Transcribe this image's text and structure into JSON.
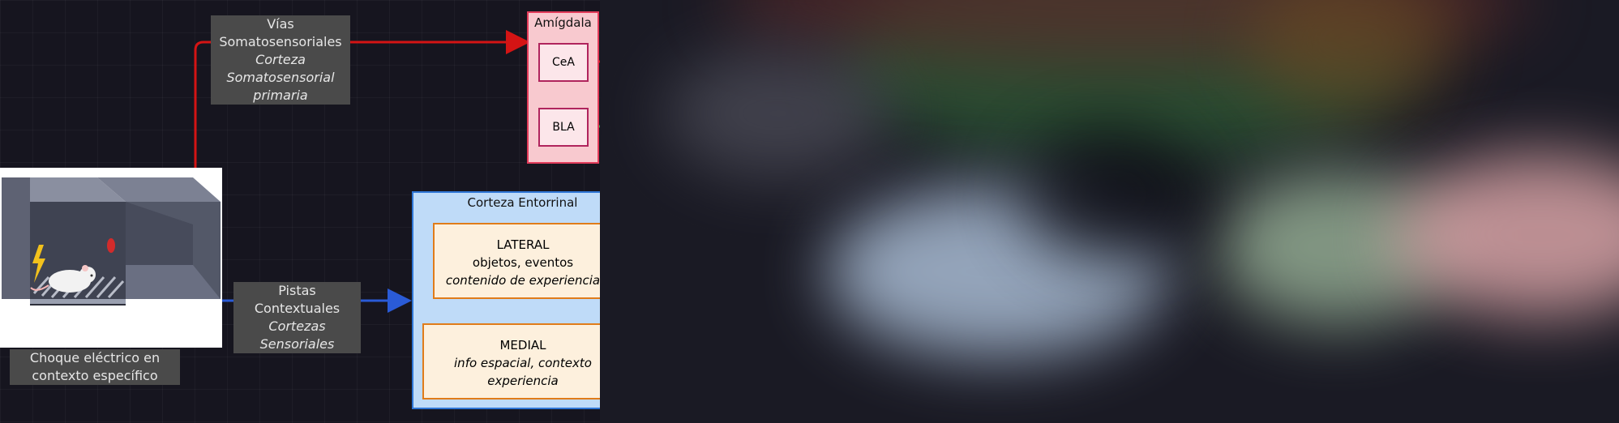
{
  "somatosensory": {
    "title": "Vías Somatosensoriales",
    "subtitle": "Corteza Somatosensorial primaria"
  },
  "amygdala": {
    "title": "Amígdala",
    "nuclei": [
      "CeA",
      "BLA"
    ],
    "color": "#f8c9cf",
    "border": "#e23b5a"
  },
  "contextual": {
    "title": "Pistas Contextuales",
    "subtitle": "Cortezas Sensoriales"
  },
  "stimulus": {
    "caption": "Choque eléctrico en contexto específico"
  },
  "entorhinal": {
    "title": "Corteza Entorrinal",
    "lateral": {
      "name": "LATERAL",
      "line1": "objetos, eventos",
      "line2": "contenido de experiencia"
    },
    "medial": {
      "name": "MEDIAL",
      "line1": "info espacial, contexto experiencia"
    },
    "color": "#bfdbf8",
    "border": "#2f76d6"
  },
  "colors": {
    "red_path": "#d41414",
    "blue_path": "#2a5bd7",
    "green_path": "#29a84a",
    "background": "#16151f"
  }
}
